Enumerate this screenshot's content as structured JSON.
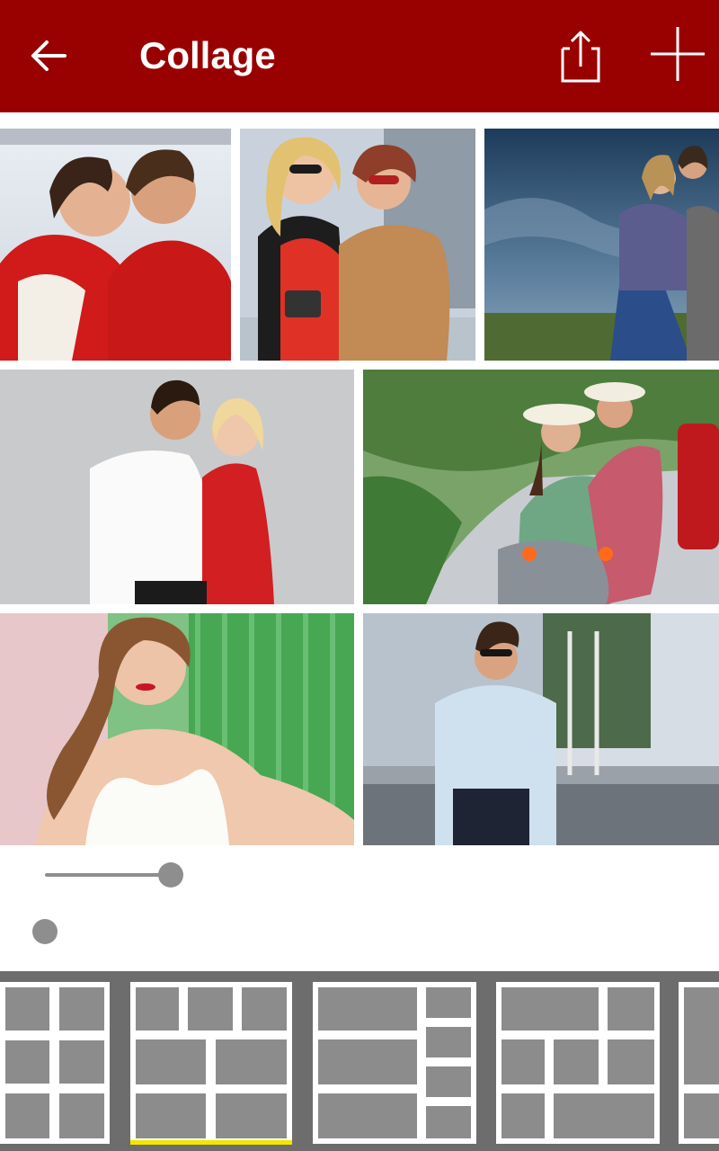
{
  "appbar": {
    "title": "Collage",
    "back_icon": "arrow-left-icon",
    "share_icon": "share-icon",
    "add_icon": "plus-icon",
    "background_color": "#990000"
  },
  "photos": [
    {
      "name": "photo-couple-red-jackets"
    },
    {
      "name": "photo-two-girls-sunglasses"
    },
    {
      "name": "photo-couple-cloudy-sky"
    },
    {
      "name": "photo-couple-studio"
    },
    {
      "name": "photo-couple-scooter"
    },
    {
      "name": "photo-woman-white-dress"
    },
    {
      "name": "photo-man-street"
    }
  ],
  "sliders": [
    {
      "name": "border-size-slider",
      "value": 1.0
    },
    {
      "name": "corner-radius-slider",
      "value": 0.0
    }
  ],
  "layouts": {
    "selected_index": 1,
    "accent_color": "#f2e500"
  }
}
